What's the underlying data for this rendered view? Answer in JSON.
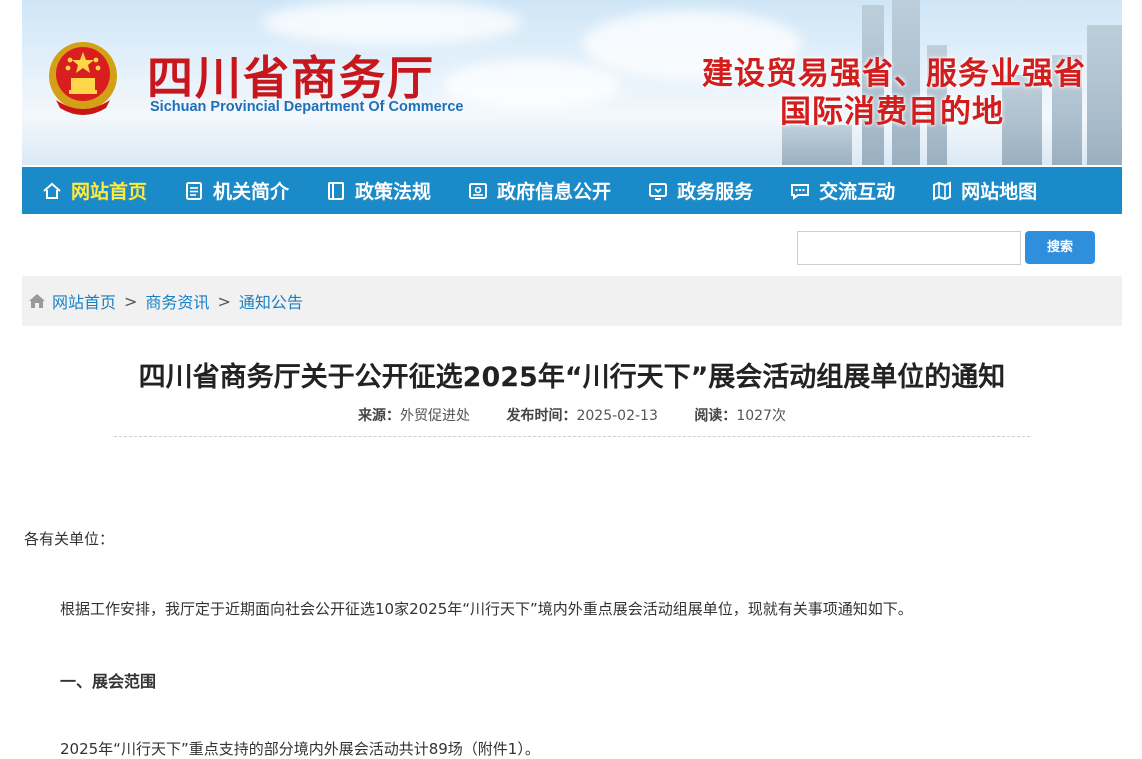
{
  "header": {
    "site_title": "四川省商务厅",
    "site_subtitle": "Sichuan Provincial Department Of Commerce",
    "slogan_line1": "建设贸易强省、服务业强省",
    "slogan_line2": "国际消费目的地"
  },
  "nav": {
    "items": [
      {
        "label": "网站首页",
        "icon": "home-icon"
      },
      {
        "label": "机关简介",
        "icon": "document-icon"
      },
      {
        "label": "政策法规",
        "icon": "book-icon"
      },
      {
        "label": "政府信息公开",
        "icon": "id-card-icon"
      },
      {
        "label": "政务服务",
        "icon": "monitor-icon"
      },
      {
        "label": "交流互动",
        "icon": "chat-icon"
      },
      {
        "label": "网站地图",
        "icon": "map-icon"
      }
    ]
  },
  "search": {
    "value": "",
    "button_label": "搜索"
  },
  "breadcrumb": {
    "items": [
      "网站首页",
      "商务资讯",
      "通知公告"
    ],
    "separator": ">"
  },
  "article": {
    "title": "四川省商务厅关于公开征选2025年“川行天下”展会活动组展单位的通知",
    "source_label": "来源：",
    "source_value": "外贸促进处",
    "date_label": "发布时间：",
    "date_value": "2025-02-13",
    "views_label": "阅读：",
    "views_value": "1027次",
    "greeting": "各有关单位：",
    "para1": "根据工作安排，我厅定于近期面向社会公开征选10家2025年“川行天下”境内外重点展会活动组展单位，现就有关事项通知如下。",
    "heading1": "一、展会范围",
    "para2": "2025年“川行天下”重点支持的部分境内外展会活动共计89场（附件1）。"
  },
  "colors": {
    "nav_bg": "#1a8ac9",
    "nav_active": "#ffeb3b",
    "title_red": "#c8161d",
    "link_blue": "#1a7fc4",
    "search_btn": "#2f8fdc"
  }
}
